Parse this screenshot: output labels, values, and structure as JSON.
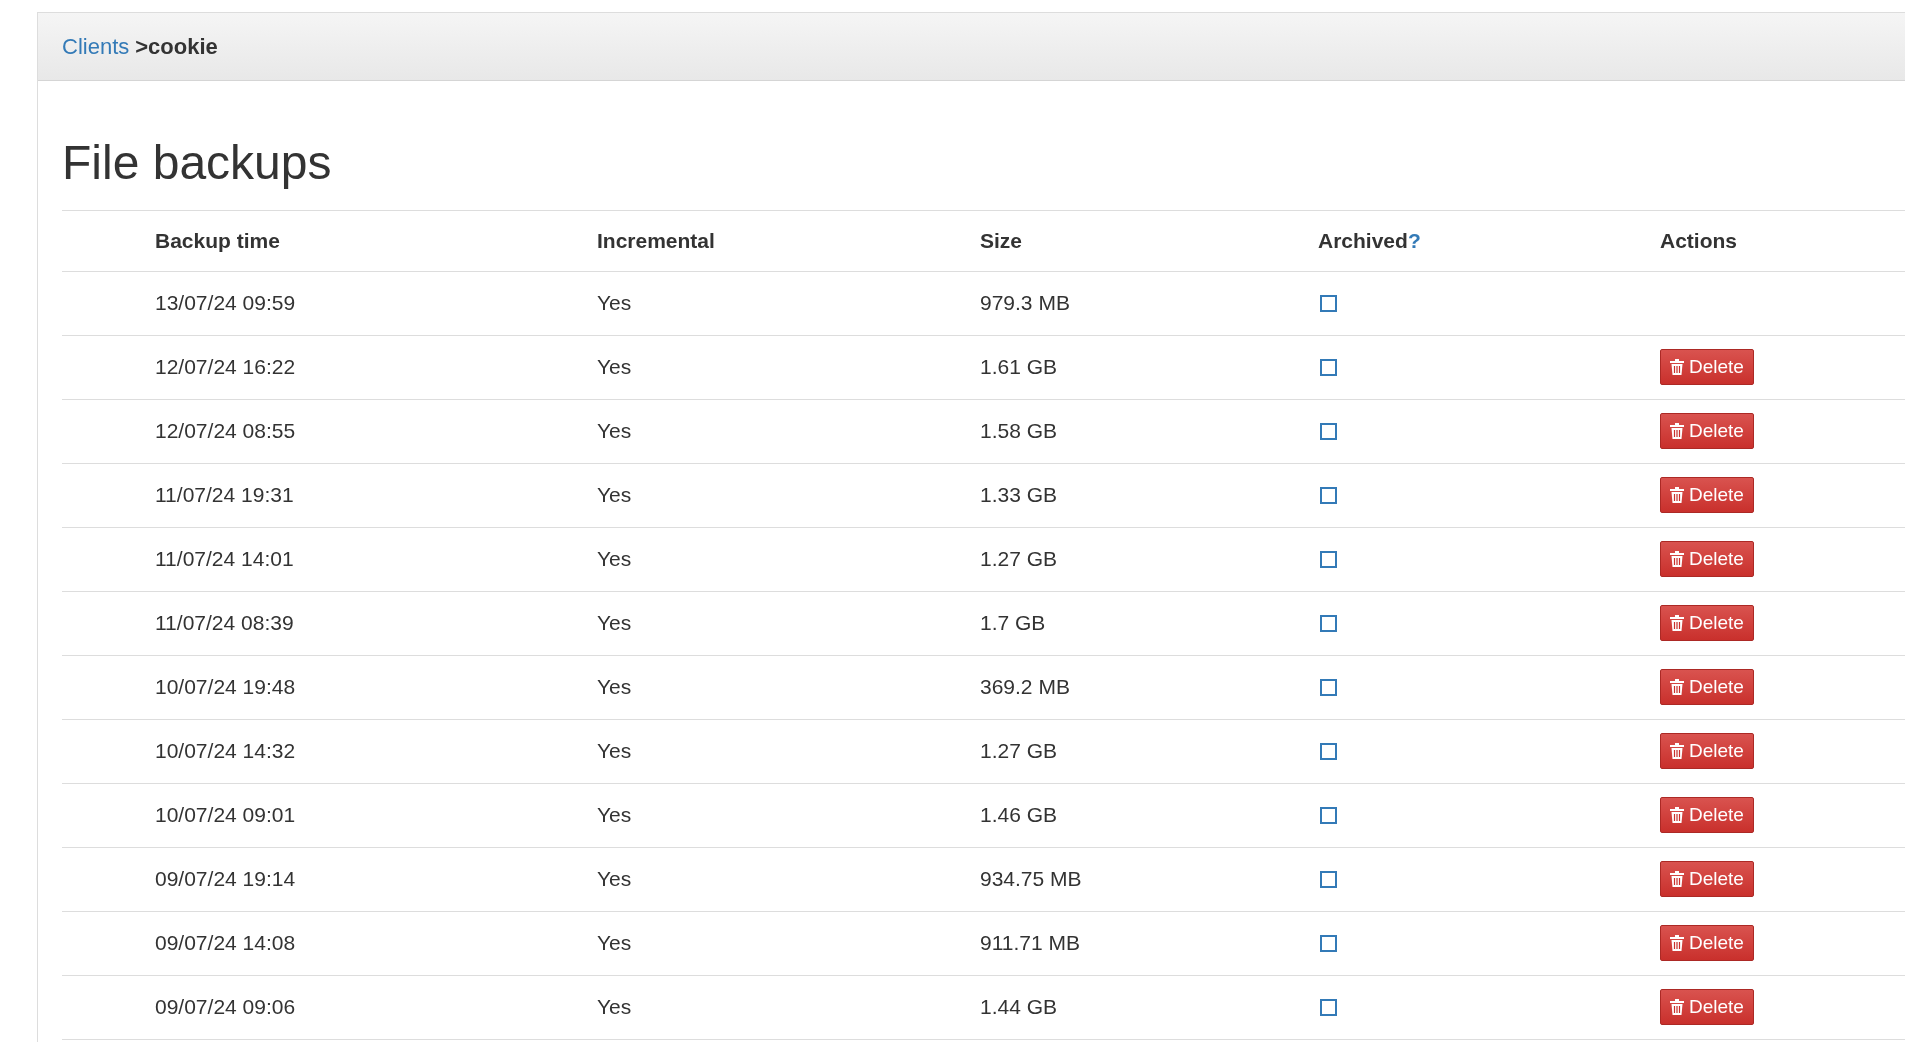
{
  "breadcrumb": {
    "link": "Clients",
    "current": ">cookie"
  },
  "title": "File backups",
  "table": {
    "columns": [
      "Backup time",
      "Incremental",
      "Size",
      "Archived",
      "Actions"
    ],
    "archived_help": "?",
    "rows": [
      {
        "time": "13/07/24 09:59",
        "incremental": "Yes",
        "size": "979.3 MB",
        "archived": false
      },
      {
        "time": "12/07/24 16:22",
        "incremental": "Yes",
        "size": "1.61 GB",
        "archived": false,
        "action": "Delete"
      },
      {
        "time": "12/07/24 08:55",
        "incremental": "Yes",
        "size": "1.58 GB",
        "archived": false,
        "action": "Delete"
      },
      {
        "time": "11/07/24 19:31",
        "incremental": "Yes",
        "size": "1.33 GB",
        "archived": false,
        "action": "Delete"
      },
      {
        "time": "11/07/24 14:01",
        "incremental": "Yes",
        "size": "1.27 GB",
        "archived": false,
        "action": "Delete"
      },
      {
        "time": "11/07/24 08:39",
        "incremental": "Yes",
        "size": "1.7 GB",
        "archived": false,
        "action": "Delete"
      },
      {
        "time": "10/07/24 19:48",
        "incremental": "Yes",
        "size": "369.2 MB",
        "archived": false,
        "action": "Delete"
      },
      {
        "time": "10/07/24 14:32",
        "incremental": "Yes",
        "size": "1.27 GB",
        "archived": false,
        "action": "Delete"
      },
      {
        "time": "10/07/24 09:01",
        "incremental": "Yes",
        "size": "1.46 GB",
        "archived": false,
        "action": "Delete"
      },
      {
        "time": "09/07/24 19:14",
        "incremental": "Yes",
        "size": "934.75 MB",
        "archived": false,
        "action": "Delete"
      },
      {
        "time": "09/07/24 14:08",
        "incremental": "Yes",
        "size": "911.71 MB",
        "archived": false,
        "action": "Delete"
      },
      {
        "time": "09/07/24 09:06",
        "incremental": "Yes",
        "size": "1.44 GB",
        "archived": false,
        "action": "Delete"
      }
    ]
  }
}
